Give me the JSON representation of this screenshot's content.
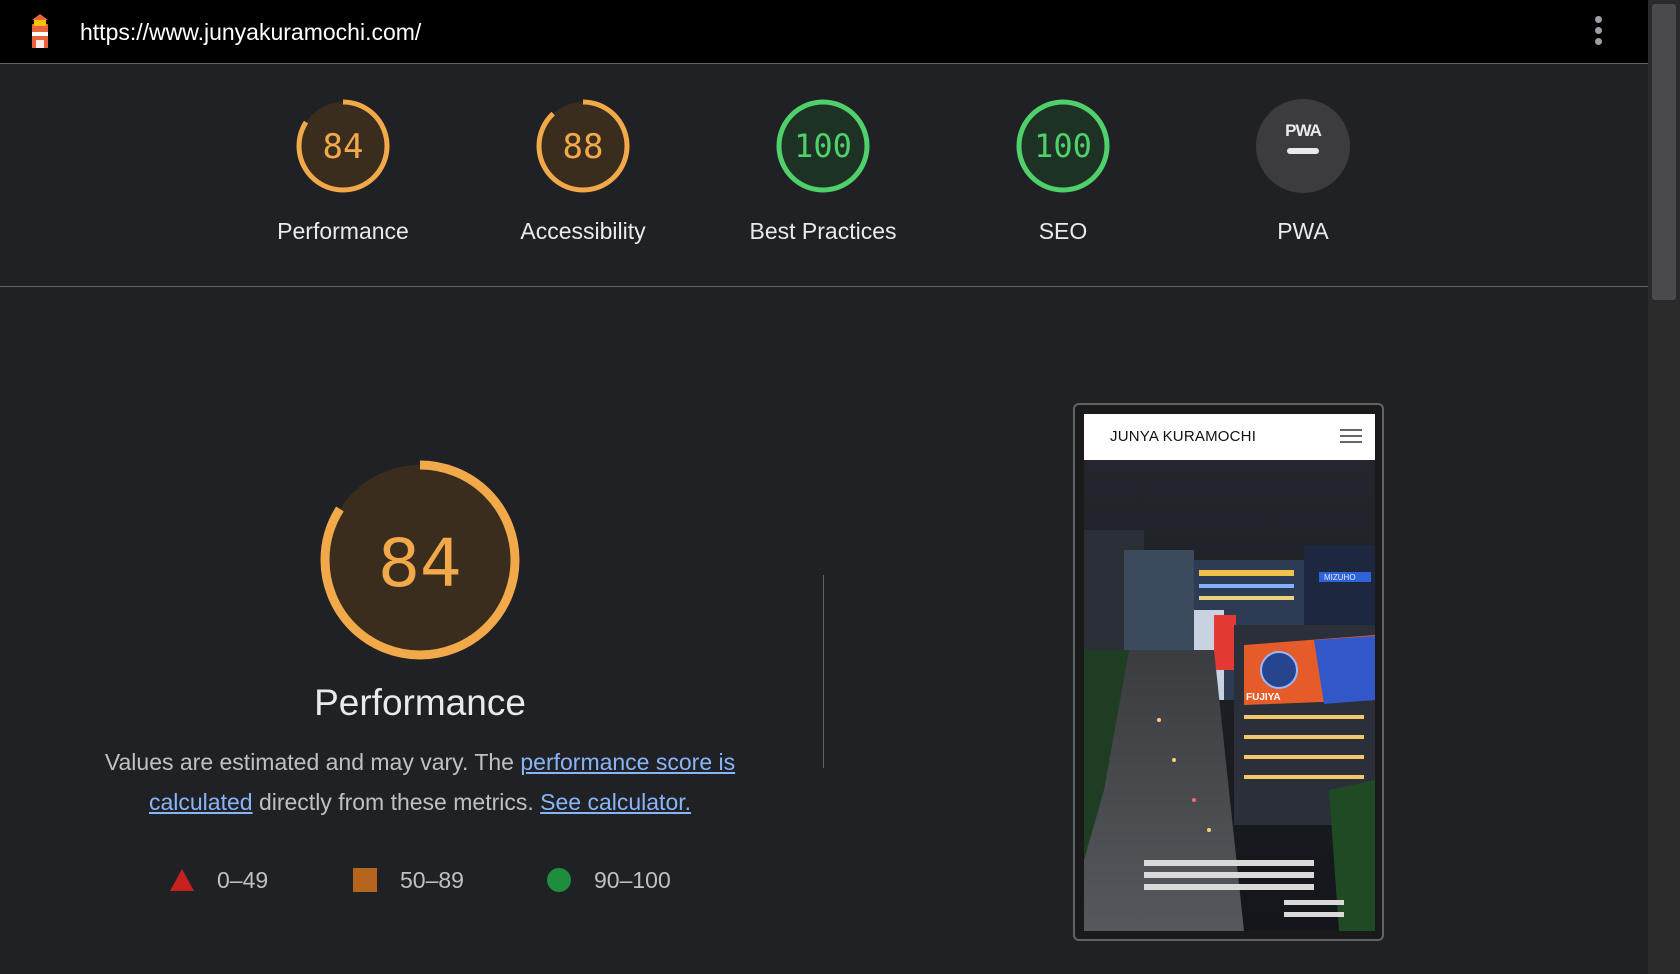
{
  "topbar": {
    "url": "https://www.junyakuramochi.com/",
    "logo_icon": "lighthouse-icon",
    "menu_icon": "kebab-menu-icon"
  },
  "categories": [
    {
      "label": "Performance",
      "score": "84",
      "score_value": 84,
      "color": "#f2a94a"
    },
    {
      "label": "Accessibility",
      "score": "88",
      "score_value": 88,
      "color": "#f2a94a"
    },
    {
      "label": "Best Practices",
      "score": "100",
      "score_value": 100,
      "color": "#4fd06b"
    },
    {
      "label": "SEO",
      "score": "100",
      "score_value": 100,
      "color": "#4fd06b"
    },
    {
      "label": "PWA",
      "badge_text": "PWA",
      "icon": "pwa-badge-icon"
    }
  ],
  "performance": {
    "score": "84",
    "score_value": 84,
    "title": "Performance",
    "desc_before": "Values are estimated and may vary. The ",
    "link1": "performance score is calculated",
    "desc_middle": " directly from these metrics. ",
    "link2": "See calculator.",
    "legend": [
      {
        "range": "0–49",
        "icon": "triangle-icon",
        "color": "#c5221f"
      },
      {
        "range": "50–89",
        "icon": "square-icon",
        "color": "#e8711a"
      },
      {
        "range": "90–100",
        "icon": "circle-icon",
        "color": "#1e8e3e"
      }
    ]
  },
  "screenshot": {
    "site_name": "JUNYA KURAMOCHI",
    "menu_icon": "hamburger-icon",
    "sign_fujiya": "FUJIYA",
    "sign_mizuho": "MIZUHO"
  }
}
